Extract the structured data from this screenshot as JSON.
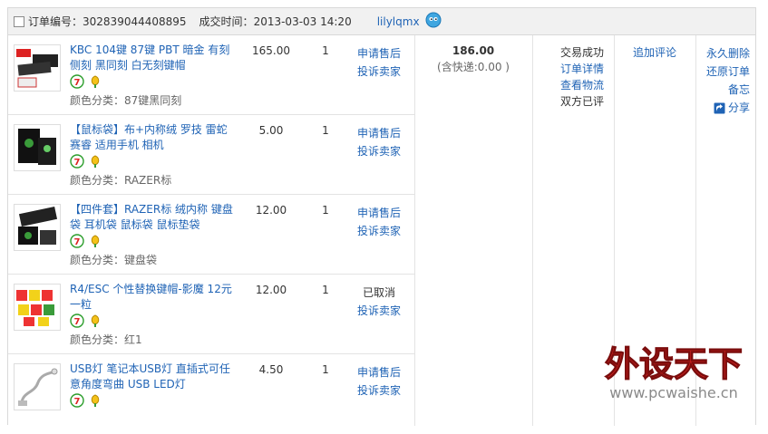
{
  "order": {
    "number_label": "订单编号：",
    "number": "302839044408895",
    "time_label": "成交时间：",
    "time": "2013-03-03 14:20",
    "buyer": "lilylqmx",
    "total": "186.00",
    "shipping": "(含快递:0.00 )",
    "status": [
      "交易成功",
      "订单详情",
      "查看物流",
      "双方已评"
    ],
    "review": "追加评论",
    "ops": [
      "永久删除",
      "还原订单",
      "备忘"
    ],
    "share": "分享"
  },
  "items": [
    {
      "title": "KBC 104键 87键 PBT 暗金 有刻侧刻 黑同刻 白无刻键帽",
      "spec": "颜色分类：87键黑同刻",
      "price": "165.00",
      "qty": "1",
      "after": [
        "申请售后",
        "投诉卖家"
      ],
      "cancelled": ""
    },
    {
      "title": "【鼠标袋】布+内称绒 罗技 雷蛇 赛睿 适用手机 相机",
      "spec": "颜色分类：RAZER标",
      "price": "5.00",
      "qty": "1",
      "after": [
        "申请售后",
        "投诉卖家"
      ],
      "cancelled": ""
    },
    {
      "title": "【四件套】RAZER标 绒内称 键盘袋 耳机袋 鼠标袋 鼠标垫袋",
      "spec": "颜色分类：键盘袋",
      "price": "12.00",
      "qty": "1",
      "after": [
        "申请售后",
        "投诉卖家"
      ],
      "cancelled": ""
    },
    {
      "title": "R4/ESC 个性替换键帽-影魔 12元一粒",
      "spec": "颜色分类：红1",
      "price": "12.00",
      "qty": "1",
      "after": [
        "",
        "投诉卖家"
      ],
      "cancelled": "已取消"
    },
    {
      "title": "USB灯 笔记本USB灯 直插式可任意角度弯曲 USB LED灯",
      "spec": "",
      "price": "4.50",
      "qty": "1",
      "after": [
        "申请售后",
        "投诉卖家"
      ],
      "cancelled": ""
    }
  ],
  "watermark": {
    "brand": "外设天下",
    "url": "www.pcwaishe.cn"
  },
  "colors": {
    "link": "#1f63b5",
    "header_bg": "#f1f1f1",
    "border": "#d9d9d9"
  }
}
